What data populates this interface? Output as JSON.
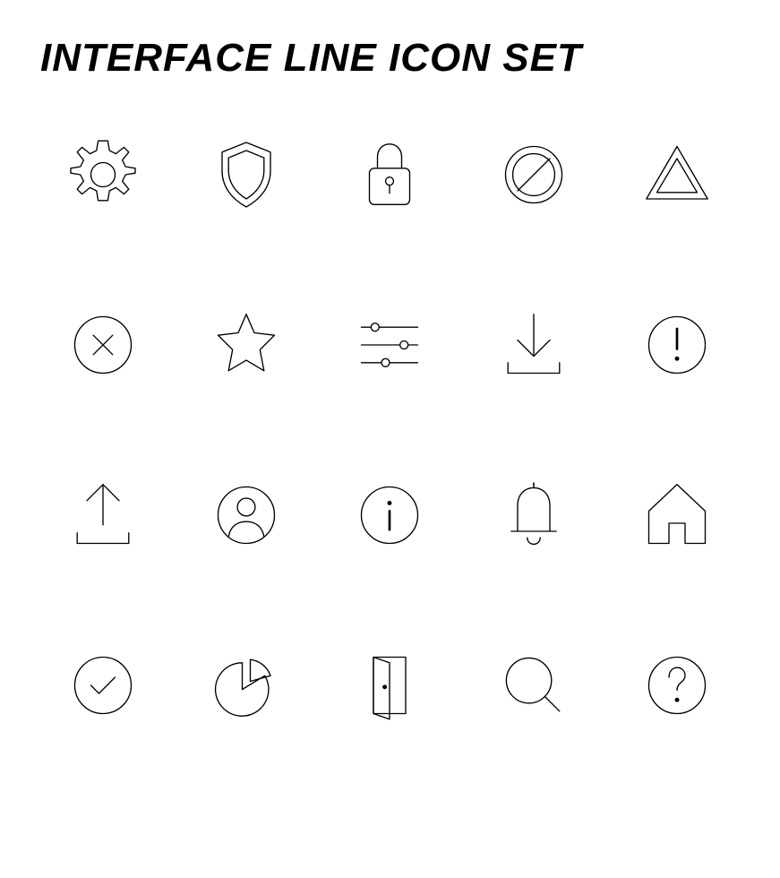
{
  "title": "INTERFACE LINE ICON SET",
  "icons": [
    {
      "name": "gear-icon",
      "row": 1,
      "col": 1
    },
    {
      "name": "shield-icon",
      "row": 1,
      "col": 2
    },
    {
      "name": "lock-icon",
      "row": 1,
      "col": 3
    },
    {
      "name": "prohibit-icon",
      "row": 1,
      "col": 4
    },
    {
      "name": "triangle-icon",
      "row": 1,
      "col": 5
    },
    {
      "name": "close-circle-icon",
      "row": 2,
      "col": 1
    },
    {
      "name": "star-icon",
      "row": 2,
      "col": 2
    },
    {
      "name": "sliders-icon",
      "row": 2,
      "col": 3
    },
    {
      "name": "download-icon",
      "row": 2,
      "col": 4
    },
    {
      "name": "alert-circle-icon",
      "row": 2,
      "col": 5
    },
    {
      "name": "upload-icon",
      "row": 3,
      "col": 1
    },
    {
      "name": "user-circle-icon",
      "row": 3,
      "col": 2
    },
    {
      "name": "info-circle-icon",
      "row": 3,
      "col": 3
    },
    {
      "name": "bell-icon",
      "row": 3,
      "col": 4
    },
    {
      "name": "home-icon",
      "row": 3,
      "col": 5
    },
    {
      "name": "check-circle-icon",
      "row": 4,
      "col": 1
    },
    {
      "name": "pie-chart-icon",
      "row": 4,
      "col": 2
    },
    {
      "name": "door-icon",
      "row": 4,
      "col": 3
    },
    {
      "name": "search-icon",
      "row": 4,
      "col": 4
    },
    {
      "name": "question-circle-icon",
      "row": 4,
      "col": 5
    }
  ]
}
